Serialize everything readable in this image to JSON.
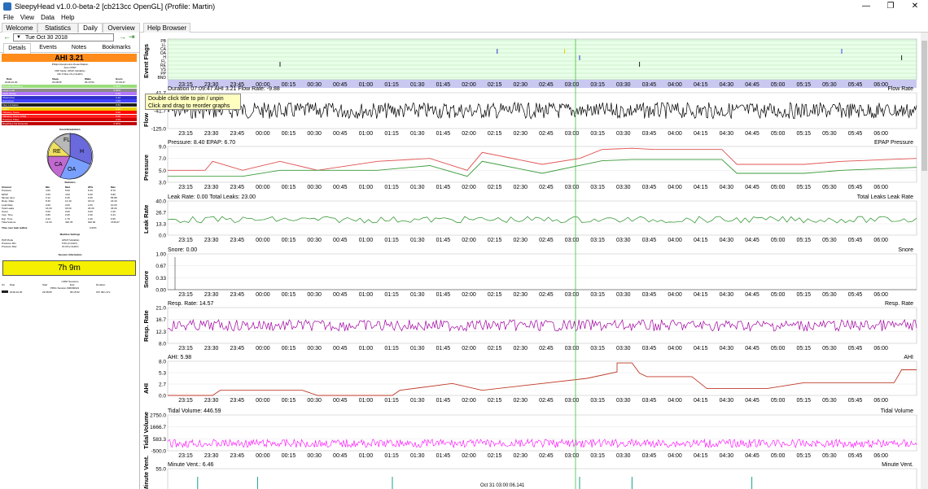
{
  "window": {
    "title": "SleepyHead v1.0.0-beta-2 [cb213cc OpenGL] (Profile: Martin)",
    "minimize": "—",
    "maximize": "❐",
    "close": "✕"
  },
  "menu": [
    "File",
    "View",
    "Data",
    "Help"
  ],
  "tabs": [
    "Welcome",
    "Statistics",
    "Daily",
    "Overview",
    "Help Browser"
  ],
  "nav": {
    "date": "Tue Oct 30 2018"
  },
  "subtabs": [
    "Details",
    "Events",
    "Notes",
    "Bookmarks"
  ],
  "ahi_banner": "AHI 3.21",
  "machine": {
    "line1": "Philips Respironics DreamStation",
    "line2": "Auto CPAP",
    "line3": "PAP Mode: APAP (Variable)",
    "line4": "Min 5 Max 16 (cmH2O)"
  },
  "session_header": [
    "Date",
    "Sleep",
    "Wake",
    "Hours"
  ],
  "session_values": [
    "2018-10-30",
    "23:08:05",
    "06:15:52",
    "07:09:47"
  ],
  "events": [
    {
      "label": "Periodic Breathing",
      "value": "0.00%",
      "color": "#9adc7c"
    },
    {
      "label": "Large Leak",
      "value": "0.00%",
      "color": "#8a8a8a"
    },
    {
      "label": "Clear Airway",
      "value": "0.00",
      "color": "#b478ff"
    },
    {
      "label": "Obstructive",
      "value": "1.12",
      "color": "#3030c8"
    },
    {
      "label": "Hypopnea",
      "value": "1.56",
      "color": "#4040ff"
    },
    {
      "label": "Flow Limitation",
      "value": "0.84",
      "color": "#202020"
    },
    {
      "label": "RERA",
      "value": "0.00",
      "color": "#e8d000"
    },
    {
      "label": "Vibratory Snore",
      "value": "0.00",
      "color": "#ff0000"
    },
    {
      "label": "Vibratory Snore (VS2)",
      "value": "0.00",
      "color": "#ff2020"
    },
    {
      "label": "Pressure Pulse",
      "value": "2.93",
      "color": "#d00000"
    },
    {
      "label": "Breathing Not Detected",
      "value": "0.00%",
      "color": "#c00000"
    }
  ],
  "event_breakdown_title": "Event Breakdown",
  "pie": [
    "FL",
    "H",
    "OA",
    "CA",
    "RE"
  ],
  "statistics": {
    "title": "Statistics",
    "header": [
      "Channel",
      "Min",
      "Med",
      "95%",
      "Max"
    ],
    "rows": [
      [
        "Pressure",
        "4.00",
        "5.00",
        "8.40",
        "8.70"
      ],
      [
        "EPAP",
        "3.00",
        "4.00",
        "6.60",
        "6.80"
      ],
      [
        "Minute Vent.",
        "0.12",
        "6.25",
        "9.25",
        "55.88"
      ],
      [
        "Resp. Rate",
        "8.46",
        "14.40",
        "18.10",
        "23.40"
      ],
      [
        "Leak Rate",
        "0.00",
        "0.00",
        "2.00",
        "10.00"
      ],
      [
        "Total Leaks",
        "16.00",
        "18.00",
        "26.00",
        "36.00"
      ],
      [
        "Snore",
        "0.00",
        "0.00",
        "0.00",
        "1.00"
      ],
      [
        "Insp. Time",
        "0.80",
        "2.00",
        "2.30",
        "6.44"
      ],
      [
        "Exp. Time",
        "0.44",
        "1.76",
        "2.46",
        "6.56"
      ],
      [
        "Tidal Volume",
        "13.33",
        "426.78",
        "620.00",
        "4736.67"
      ]
    ]
  },
  "time_over_leak": {
    "label": "Time over leak redline",
    "value": "0.00%"
  },
  "machine_settings": {
    "title": "Machine Settings",
    "rows": [
      [
        "PAP Mode",
        "APAP (Variable)"
      ],
      [
        "Pressure Min",
        "5.00 (cmH2O)"
      ],
      [
        "Pressure Max",
        "16.00 (cmH2O)"
      ]
    ]
  },
  "session_info": {
    "title": "Session Information",
    "duration": "7h 9m"
  },
  "cpap_sessions": {
    "title": "CPAP Sessions",
    "header": [
      "On",
      "Date",
      "Start",
      "End",
      "Duration"
    ],
    "row": [
      "",
      "2018-10-30",
      "23:08:05",
      "06:15:52",
      "07h 09m 47s"
    ],
    "sub": "PRS1 Session #00000021"
  },
  "x_labels": [
    "23:15",
    "23:30",
    "23:45",
    "00:00",
    "00:15",
    "00:30",
    "00:45",
    "01:00",
    "01:15",
    "01:30",
    "01:45",
    "02:00",
    "02:15",
    "02:30",
    "02:45",
    "03:00",
    "03:15",
    "03:30",
    "03:45",
    "04:00",
    "04:15",
    "04:30",
    "04:45",
    "05:00",
    "05:15",
    "05:30",
    "05:45",
    "06:00"
  ],
  "tooltip": [
    "Double click title to pin / unpin",
    "Click and drag to reorder graphs"
  ],
  "graphs": [
    {
      "id": "flags",
      "ylabel": "Event Flags",
      "flags": [
        "PB",
        "LL",
        "CA",
        "OA",
        "H",
        "FL",
        "RE",
        "VS",
        "PP",
        "BND"
      ]
    },
    {
      "id": "flow",
      "ylabel": "Flow",
      "info": "Duration 07:09:47 AHI 3.21 Flow Rate: -9.88",
      "legend": "Flow Rate",
      "ticks": [
        "41.7",
        "-41.7",
        "-125.0"
      ],
      "color": "#000000"
    },
    {
      "id": "pressure",
      "ylabel": "Pressure",
      "info": "Pressure: 8.40 EPAP: 6.70",
      "legend": "EPAP  Pressure",
      "ticks": [
        "9.0",
        "7.0",
        "5.0",
        "3.0"
      ]
    },
    {
      "id": "leak",
      "ylabel": "Leak Rate",
      "info": "Leak Rate: 0.00 Total Leaks: 23.00",
      "legend": "Total Leaks  Leak Rate",
      "ticks": [
        "40.0",
        "26.7",
        "13.3",
        "0.0"
      ]
    },
    {
      "id": "snore",
      "ylabel": "Snore",
      "info": "Snore: 0.00",
      "legend": "Snore",
      "ticks": [
        "1.00",
        "0.67",
        "0.33",
        "0.00"
      ]
    },
    {
      "id": "resp",
      "ylabel": "Resp. Rate",
      "info": "Resp. Rate: 14.57",
      "legend": "Resp. Rate",
      "ticks": [
        "21.0",
        "16.7",
        "12.3",
        "8.0"
      ]
    },
    {
      "id": "ahi",
      "ylabel": "AHI",
      "info": "AHI: 5.98",
      "legend": "AHI",
      "ticks": [
        "8.0",
        "5.3",
        "2.7",
        "0.0"
      ]
    },
    {
      "id": "tidal",
      "ylabel": "Tidal Volume",
      "info": "Tidal Volume: 446.59",
      "legend": "Tidal Volume",
      "ticks": [
        "2750.0",
        "1666.7",
        "583.3",
        "-500.0"
      ]
    },
    {
      "id": "minute",
      "ylabel": "Minute Vent.",
      "info": "Minute Vent.: 6.46",
      "legend": "Minute Vent.",
      "ticks": [
        "55.0",
        "36.7"
      ]
    }
  ],
  "status": {
    "left": "  ",
    "center": "Oct 31 03:00:06.141"
  },
  "colors": {
    "flow": "#000000",
    "pressure": "#e05050",
    "epap": "#3a9a3a",
    "leak": "#3a9a3a",
    "resp": "#a000a0",
    "ahi": "#c03a2a",
    "tidal": "#ff00ff",
    "minute": "#1aa08a",
    "cursor": "#40c040",
    "flagbg": "#e8ffe8"
  }
}
